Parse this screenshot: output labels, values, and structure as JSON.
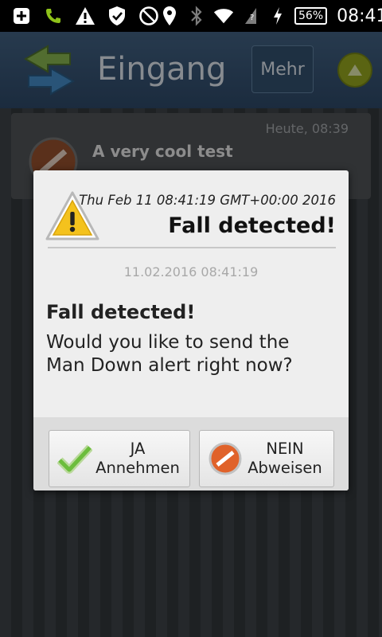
{
  "status_bar": {
    "icons": [
      "add-box-icon",
      "phone-call-icon",
      "warning-icon",
      "shield-check-icon",
      "block-icon",
      "location-pin-icon",
      "bluetooth-icon",
      "wifi-icon",
      "mobile-data-icon",
      "charging-icon"
    ],
    "battery": "56%",
    "time": "08:41"
  },
  "action_bar": {
    "title": "Eingang",
    "more_label": "Mehr"
  },
  "message": {
    "date": "Heute, 08:39",
    "title": "A very cool test"
  },
  "dialog": {
    "datetime": "Thu Feb 11 08:41:19 GMT+00:00 2016",
    "title": "Fall detected!",
    "timestamp": "11.02.2016 08:41:19",
    "heading": "Fall detected!",
    "body_line1": "Would you like to send the",
    "body_line2": "Man Down alert right now?",
    "accept": {
      "line1": "JA",
      "line2": "Annehmen"
    },
    "reject": {
      "line1": "NEIN",
      "line2": "Abweisen"
    }
  },
  "colors": {
    "action_bar": "#2a4360",
    "dialog_bg": "#eeeeee",
    "accept_green": "#7cc24a",
    "reject_orange": "#e0622a"
  }
}
